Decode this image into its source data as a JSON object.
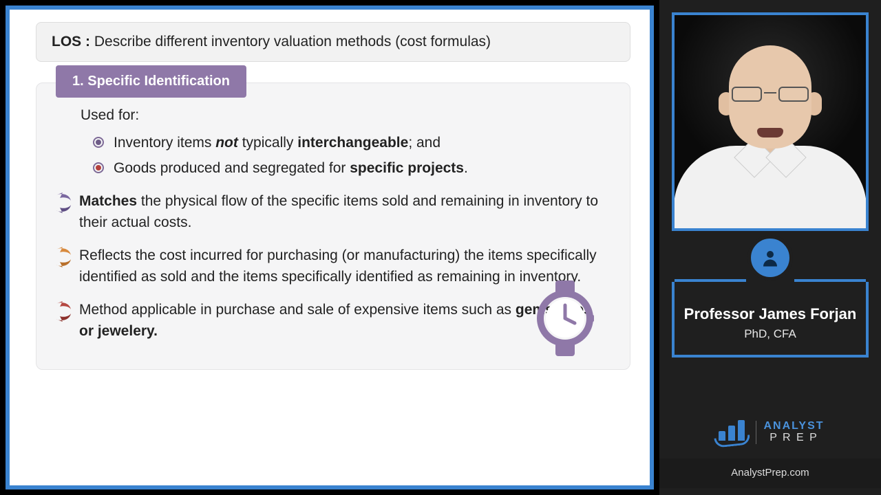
{
  "los": {
    "label": "LOS :",
    "text": "Describe different inventory valuation methods (cost formulas)"
  },
  "section": {
    "number": "1.",
    "title": "Specific Identification"
  },
  "usedFor": "Used for:",
  "bullets": [
    {
      "pre": "Inventory items ",
      "em": "not",
      "mid": " typically ",
      "strong": "interchangeable",
      "post": "; and"
    },
    {
      "pre": "Goods produced and segregated for ",
      "strong": "specific projects",
      "post": "."
    }
  ],
  "paras": [
    {
      "lead": "Matches",
      "rest": " the physical flow of the specific items sold and remaining in inventory to their actual costs."
    },
    {
      "rest": "Reflects the cost incurred for purchasing (or manufacturing) the items specifically identified as sold and the items specifically identified as remaining in inventory."
    },
    {
      "rest_pre": "Method applicable in purchase and sale of expensive items such as ",
      "strong": "gemstones or jewelery."
    }
  ],
  "presenter": {
    "name": "Professor James Forjan",
    "credentials": "PhD, CFA"
  },
  "brand": {
    "top": "ANALYST",
    "bottom": "P R E P",
    "site": "AnalystPrep.com"
  },
  "icons": {
    "watch": "watch-icon",
    "avatar": "avatar-icon"
  },
  "colors": {
    "accent": "#3a83d0",
    "tag": "#8f78a8"
  }
}
